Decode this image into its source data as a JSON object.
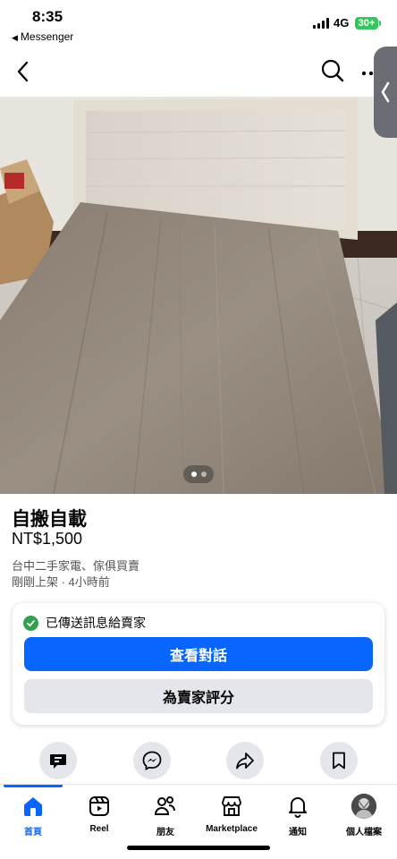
{
  "status_bar": {
    "time": "8:35",
    "back_app": "Messenger",
    "network": "4G",
    "battery": "30+",
    "battery_color": "#34c759"
  },
  "nav": {
    "back_icon": "chevron-left-icon",
    "search_icon": "search-icon",
    "more_icon": "more-horizontal-icon"
  },
  "gallery": {
    "image_alt": "Bed frame with light grey wood headboard and wood-grain platform",
    "page_count": 2,
    "current_page": 1
  },
  "listing": {
    "title": "自搬自載",
    "price": "NT$1,500",
    "location": "台中二手家電、傢俱買賣",
    "posted": "剛剛上架 · 4小時前"
  },
  "message_card": {
    "status_text": "已傳送訊息給賣家",
    "primary_button": "查看對話",
    "secondary_button": "為賣家評分"
  },
  "actions": [
    {
      "icon": "chat-alert-icon"
    },
    {
      "icon": "messenger-icon"
    },
    {
      "icon": "share-icon"
    },
    {
      "icon": "bookmark-icon"
    }
  ],
  "tabs": [
    {
      "label": "首頁",
      "icon": "home-icon",
      "active": true
    },
    {
      "label": "Reel",
      "icon": "reels-icon",
      "active": false
    },
    {
      "label": "朋友",
      "icon": "friends-icon",
      "active": false
    },
    {
      "label": "Marketplace",
      "icon": "marketplace-icon",
      "active": false
    },
    {
      "label": "通知",
      "icon": "bell-icon",
      "active": false
    },
    {
      "label": "個人檔案",
      "icon": "profile-avatar",
      "active": false
    }
  ],
  "colors": {
    "accent": "#0866ff",
    "success": "#31a24c",
    "secondary_button": "#e4e6eb"
  }
}
